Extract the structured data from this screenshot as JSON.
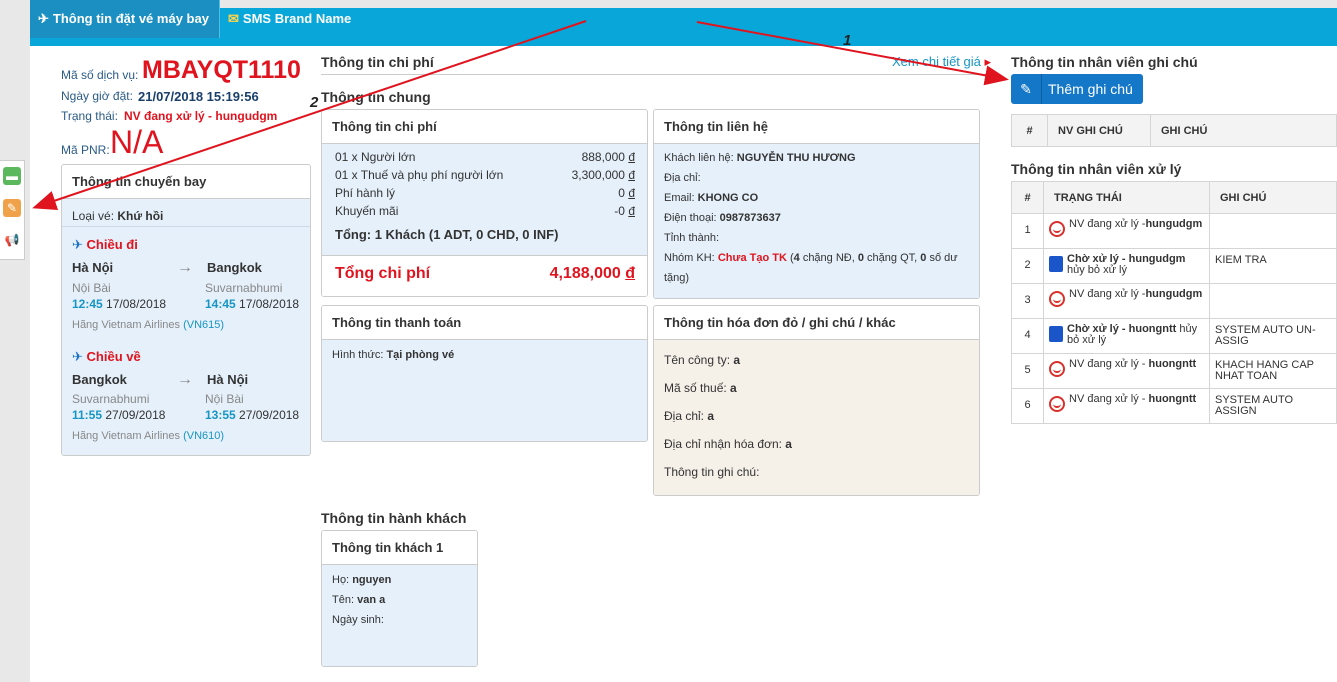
{
  "tabs": [
    {
      "label": "Thông tin đặt vé máy bay",
      "icon": "plane-icon"
    },
    {
      "label": "SMS Brand Name",
      "icon": "envelope-icon"
    }
  ],
  "service": {
    "code_label": "Mã số dịch vụ:",
    "code": "MBAYQT1110",
    "date_label": "Ngày giờ đặt:",
    "date": "21/07/2018 15:19:56",
    "status_label": "Trạng thái:",
    "status": "NV đang xử lý - hungudgm",
    "pnr_label": "Mã PNR:",
    "pnr": "N/A"
  },
  "annotations": {
    "arrow1": "1",
    "arrow2": "2"
  },
  "flight": {
    "title": "Thông tin chuyến bay",
    "ticket_type_label": "Loại vé:",
    "ticket_type": "Khứ hồi",
    "outbound": {
      "label": "Chiều đi",
      "from_city": "Hà Nội",
      "from_airport": "Nội Bài",
      "from_time": "12:45",
      "from_date": "17/08/2018",
      "to_city": "Bangkok",
      "to_airport": "Suvarnabhumi",
      "to_time": "14:45",
      "to_date": "17/08/2018",
      "airline_label": "Hãng Vietnam Airlines",
      "flight_no": "(VN615)"
    },
    "return": {
      "label": "Chiều về",
      "from_city": "Bangkok",
      "from_airport": "Suvarnabhumi",
      "from_time": "11:55",
      "from_date": "27/09/2018",
      "to_city": "Hà Nội",
      "to_airport": "Nội Bài",
      "to_time": "13:55",
      "to_date": "27/09/2018",
      "airline_label": "Hãng Vietnam Airlines",
      "flight_no": "(VN610)"
    }
  },
  "cost": {
    "section_title": "Thông tin chi phí",
    "detail_link": "Xem chi tiết giá",
    "general_title": "Thông tin chung",
    "box_title": "Thông tin chi phí",
    "lines": [
      {
        "label": "01 x Người lớn",
        "value": "888,000",
        "cur": "đ"
      },
      {
        "label": "01 x Thuế và phụ phí người lớn",
        "value": "3,300,000",
        "cur": "đ"
      },
      {
        "label": "Phí hành lý",
        "value": "0",
        "cur": "đ"
      },
      {
        "label": "Khuyến mãi",
        "value": "-0",
        "cur": "đ"
      }
    ],
    "summary": "Tổng: 1 Khách (1 ADT, 0 CHD, 0 INF)",
    "total_label": "Tổng chi phí",
    "total_value": "4,188,000",
    "total_cur": "đ"
  },
  "contact": {
    "title": "Thông tin liên hệ",
    "name_label": "Khách liên hệ:",
    "name": "NGUYỄN THU HƯƠNG",
    "address_label": "Địa chỉ:",
    "email_label": "Email:",
    "email": "KHONG CO",
    "phone_label": "Điện thoại:",
    "phone": "0987873637",
    "province_label": "Tỉnh thành:",
    "group_label": "Nhóm KH:",
    "group_value": "Chưa Tạo TK",
    "group_detail_1": "(",
    "nd_count": "4",
    "nd_text": "chặng NĐ,",
    "qt_count": "0",
    "qt_text": "chặng QT,",
    "gift_count": "0",
    "gift_text": "số dư",
    "gift_line2": "tặng)"
  },
  "payment": {
    "title": "Thông tin thanh toán",
    "method_label": "Hình thức:",
    "method": "Tại phòng vé"
  },
  "invoice": {
    "title": "Thông tin hóa đơn đỏ / ghi chú / khác",
    "company_label": "Tên công ty:",
    "company": "a",
    "tax_label": "Mã số thuế:",
    "tax": "a",
    "address_label": "Địa chỉ:",
    "address": "a",
    "receiver_label": "Địa chỉ nhận hóa đơn:",
    "receiver": "a",
    "note_label": "Thông tin ghi chú:"
  },
  "passengers": {
    "section_title": "Thông tin hành khách",
    "box_title": "Thông tin khách 1",
    "last_name_label": "Họ:",
    "last_name": "nguyen",
    "first_name_label": "Tên:",
    "first_name": "van a",
    "dob_label": "Ngày sinh:"
  },
  "notes": {
    "title": "Thông tin nhân viên ghi chú",
    "add_button": "Thêm ghi chú",
    "columns": [
      "#",
      "NV GHI CHÚ",
      "GHI CHÚ"
    ]
  },
  "handlers": {
    "title": "Thông tin nhân viên xử lý",
    "columns": [
      "#",
      "TRẠNG THÁI",
      "GHI CHÚ"
    ],
    "rows": [
      {
        "no": "1",
        "icon": "face",
        "status": "NV đang xử lý -",
        "user": "hungudgm",
        "note": ""
      },
      {
        "no": "2",
        "icon": "person",
        "status": "Chờ xử lý - ",
        "user": "hungudgm",
        "extra": "hủy bỏ xử lý",
        "note": "KIEM TRA"
      },
      {
        "no": "3",
        "icon": "face",
        "status": "NV đang xử lý -",
        "user": "hungudgm",
        "note": ""
      },
      {
        "no": "4",
        "icon": "person",
        "status": "Chờ xử lý - ",
        "user": "huongntt",
        "extra": "hủy bỏ xử lý",
        "note": "SYSTEM AUTO UN-ASSIG"
      },
      {
        "no": "5",
        "icon": "face",
        "status": "NV đang xử lý - ",
        "user": "huongntt",
        "note": "KHACH HANG CAP NHAT TOAN"
      },
      {
        "no": "6",
        "icon": "face",
        "status": "NV đang xử lý - ",
        "user": "huongntt",
        "note": "SYSTEM AUTO ASSIGN"
      }
    ]
  }
}
